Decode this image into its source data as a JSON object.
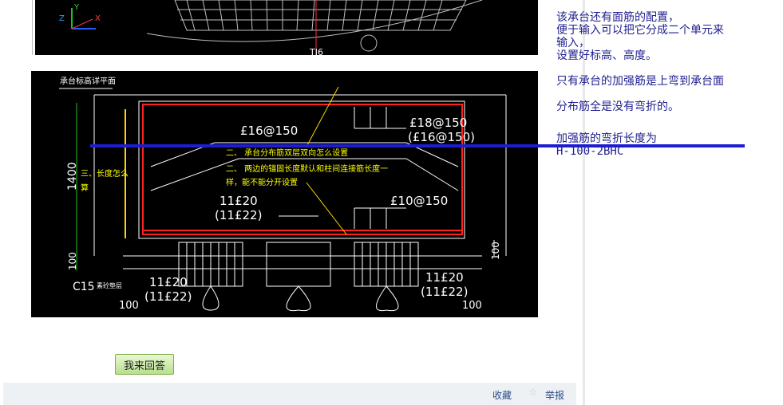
{
  "top_drawing": {
    "axis_z": "Z",
    "axis_y": "Y",
    "axis_x": "X",
    "label": "TJ6"
  },
  "drawing": {
    "top_label": "承台标高详平面",
    "rebar_top_left": "£16@150",
    "rebar_top_right_1": "£18@150",
    "rebar_top_right_2": "(£16@150)",
    "rebar_mid_left_1": "11£20",
    "rebar_mid_left_2": "(11£22)",
    "rebar_mid_right": "£10@150",
    "bottom_left_1": "11£20",
    "bottom_left_2": "(11£22)",
    "bottom_right_1": "11£20",
    "bottom_right_2": "(11£22)",
    "dim_height": "1400",
    "dim_100_left": "100",
    "dim_100_right": "100",
    "dim_100_bottom_left": "100",
    "dim_100_bottom_right": "100",
    "c15_label": "C15",
    "c15_note": "素砼垫层",
    "q1": "二、 承台分布筋双层双向怎么设置",
    "q2a": "二、 两边的锚固长度默认和柱间连接筋长度一",
    "q2b": "样，能不能分开设置",
    "q3a": "三、长度怎么",
    "q3b": "算"
  },
  "note": {
    "line1": "该承台还有面筋的配置，",
    "line2": "便于输入可以把它分成二个单元来",
    "line3": "输入，",
    "line4": "设置好标高、高度。",
    "line5": "只有承台的加强筋是上弯到承台面",
    "line6": "分布筋全是没有弯折的。",
    "line7": "加强筋的弯折长度为",
    "line8": "H-100-2BHC"
  },
  "actions": {
    "answer_label": "我来回答",
    "favorite_label": "收藏",
    "report_label": "举报"
  },
  "colors": {
    "cad_background": "#000000",
    "rebar_red": "#ff2020",
    "annotation_yellow": "#ffff00",
    "drawing_white": "#ffffff",
    "note_blue": "#1f1f8f",
    "strike_line_blue": "#1e1ed0",
    "button_green": "#b7df8c"
  }
}
